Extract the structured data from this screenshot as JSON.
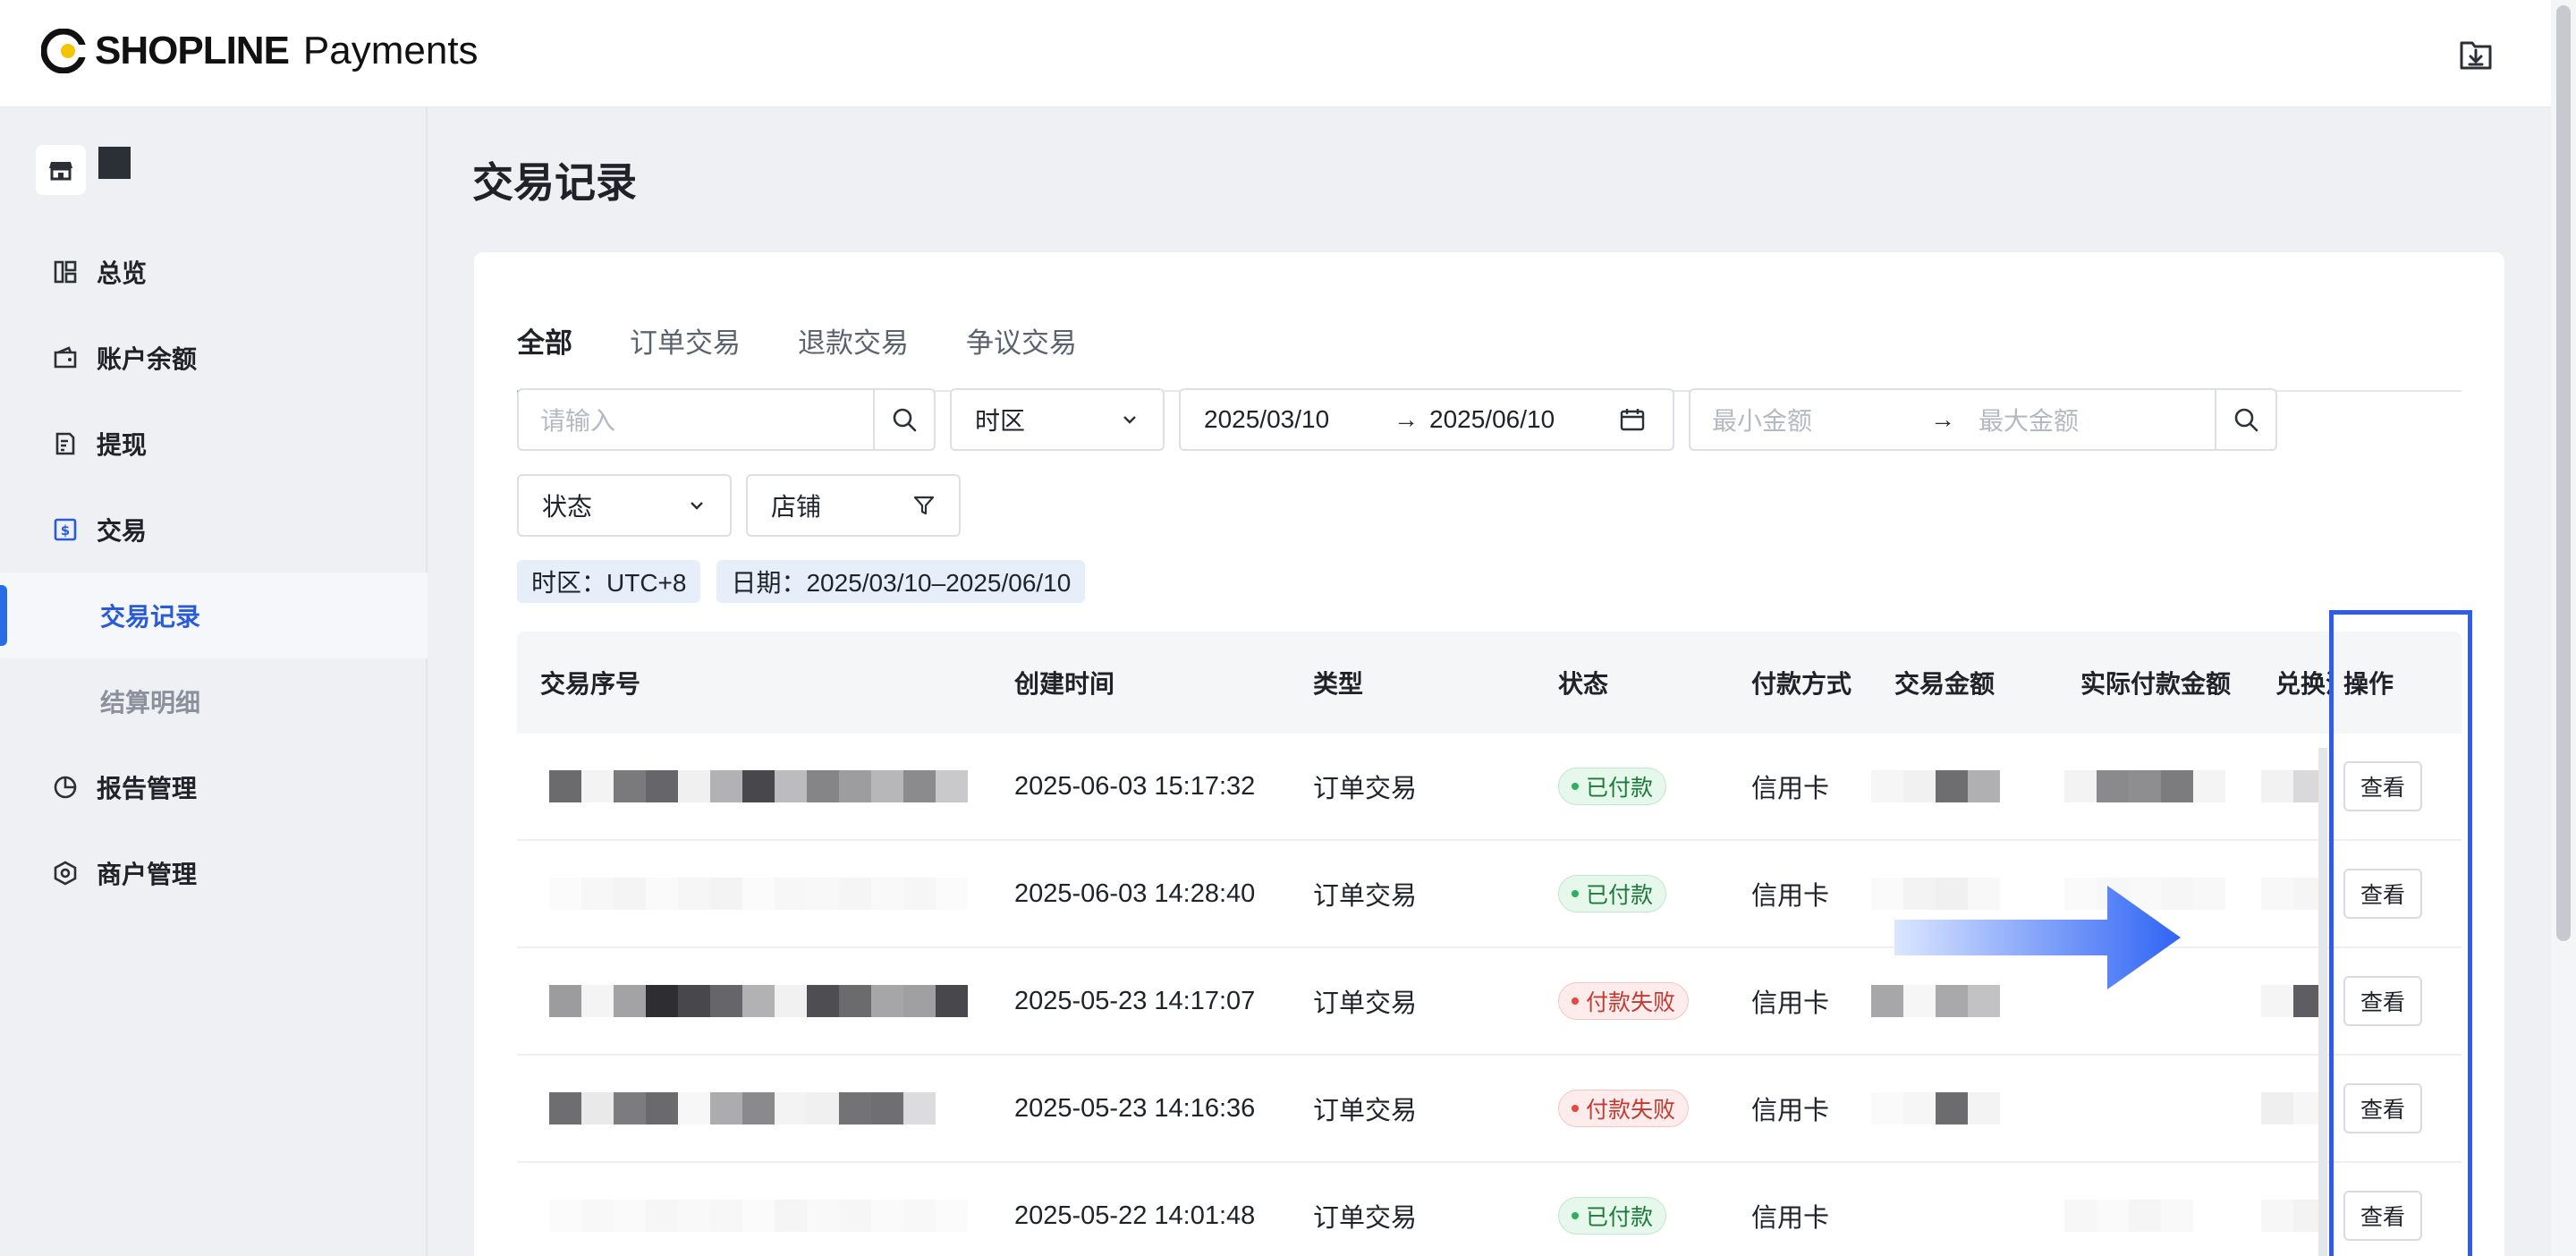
{
  "header": {
    "brand": "SHOPLINE",
    "product": "Payments",
    "download_icon": "download-box-icon"
  },
  "sidebar": {
    "store_icon": "store-icon",
    "items": [
      {
        "label": "总览",
        "icon": "dashboard-icon"
      },
      {
        "label": "账户余额",
        "icon": "wallet-icon"
      },
      {
        "label": "提现",
        "icon": "withdraw-icon"
      },
      {
        "label": "交易",
        "icon": "dollar-doc-icon"
      },
      {
        "label": "交易记录",
        "sub": true,
        "active": true
      },
      {
        "label": "结算明细",
        "sub": true
      },
      {
        "label": "报告管理",
        "icon": "pie-chart-icon"
      },
      {
        "label": "商户管理",
        "icon": "hexagon-icon"
      }
    ]
  },
  "main": {
    "title": "交易记录",
    "tabs": [
      "全部",
      "订单交易",
      "退款交易",
      "争议交易"
    ],
    "filters": {
      "search_placeholder": "请输入",
      "timezone_label": "时区",
      "date_from": "2025/03/10",
      "date_to": "2025/06/10",
      "date_arrow": "→",
      "min_amount_placeholder": "最小金额",
      "max_amount_placeholder": "最大金额",
      "status_label": "状态",
      "store_label": "店铺"
    },
    "chips": [
      "时区：UTC+8",
      "日期：2025/03/10–2025/06/10"
    ],
    "table": {
      "columns": [
        "交易序号",
        "创建时间",
        "类型",
        "状态",
        "付款方式",
        "交易金额",
        "实际付款金额",
        "兑换汇",
        "操作"
      ],
      "rows": [
        {
          "time": "2025-06-03 15:17:32",
          "type": "订单交易",
          "status": "已付款",
          "status_kind": "ok",
          "method": "信用卡",
          "action": "查看"
        },
        {
          "time": "2025-06-03 14:28:40",
          "type": "订单交易",
          "status": "已付款",
          "status_kind": "ok",
          "method": "信用卡",
          "action": "查看"
        },
        {
          "time": "2025-05-23 14:17:07",
          "type": "订单交易",
          "status": "付款失败",
          "status_kind": "fail",
          "method": "信用卡",
          "action": "查看"
        },
        {
          "time": "2025-05-23 14:16:36",
          "type": "订单交易",
          "status": "付款失败",
          "status_kind": "fail",
          "method": "信用卡",
          "action": "查看"
        },
        {
          "time": "2025-05-22 14:01:48",
          "type": "订单交易",
          "status": "已付款",
          "status_kind": "ok",
          "method": "信用卡",
          "action": "查看"
        }
      ]
    }
  },
  "colors": {
    "accent": "#2a6be6",
    "highlight_box": "#2f5ce8",
    "success": "#2bb15a",
    "danger": "#e5483f"
  }
}
